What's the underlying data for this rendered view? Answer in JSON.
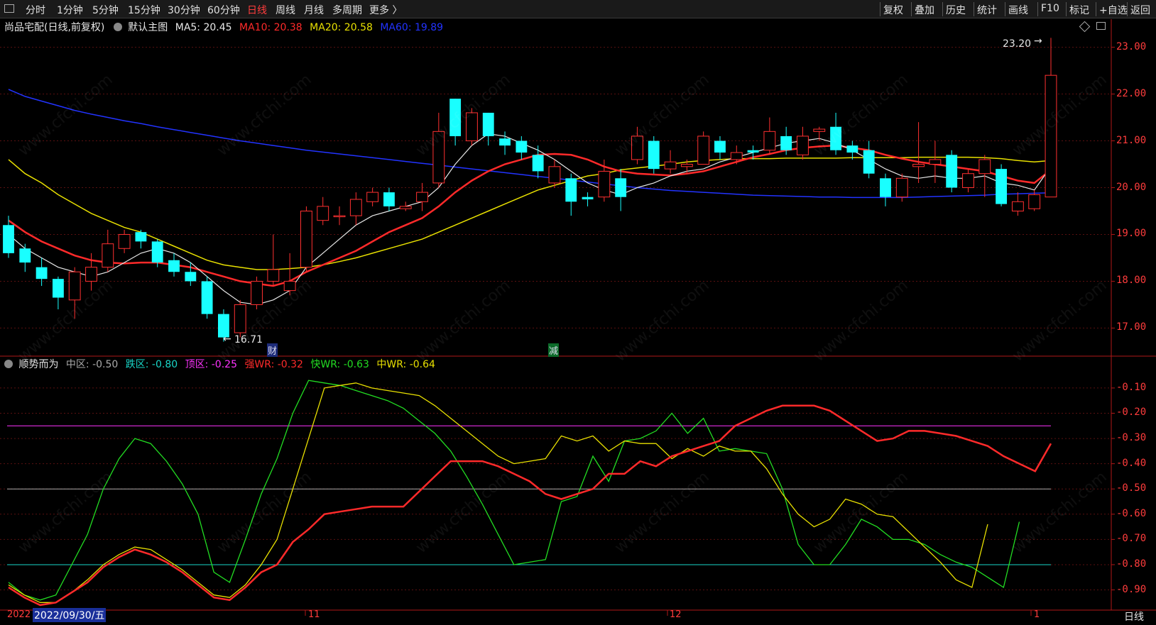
{
  "toolbar": {
    "periods": [
      "分时",
      "1分钟",
      "5分钟",
      "15分钟",
      "30分钟",
      "60分钟",
      "日线",
      "周线",
      "月线",
      "多周期",
      "更多 〉"
    ],
    "active_period": "日线",
    "right_buttons": [
      "复权",
      "叠加",
      "历史",
      "统计",
      "画线",
      "F10",
      "标记",
      "+自选",
      "返回"
    ]
  },
  "main_panel": {
    "stock_name": "尚品宅配(日线,前复权)",
    "template": "默认主图",
    "ma5": {
      "label": "MA5: 20.45",
      "color": "#e8e8e8"
    },
    "ma10": {
      "label": "MA10: 20.38",
      "color": "#ff2a2a"
    },
    "ma20": {
      "label": "MA20: 20.58",
      "color": "#e8e000"
    },
    "ma60": {
      "label": "MA60: 19.89",
      "color": "#2233ff"
    },
    "high_label": "23.20",
    "low_label": "16.71",
    "y_ticks": [
      "23.00",
      "22.00",
      "21.00",
      "20.00",
      "19.00",
      "18.00",
      "17.00"
    ],
    "event_markers": [
      "财",
      "减"
    ]
  },
  "indicator_panel": {
    "name": "顺势而为",
    "mid": {
      "label": "中区: -0.50",
      "color": "#aaaaaa"
    },
    "low": {
      "label": "跌区: -0.80",
      "color": "#19d6c8"
    },
    "top": {
      "label": "顶区: -0.25",
      "color": "#ff33ff"
    },
    "strong": {
      "label": "强WR: -0.32",
      "color": "#ff2a2a"
    },
    "fast": {
      "label": "快WR: -0.63",
      "color": "#22dd22"
    },
    "medium": {
      "label": "中WR: -0.64",
      "color": "#e8e000"
    },
    "y_ticks": [
      "-0.10",
      "-0.20",
      "-0.30",
      "-0.40",
      "-0.50",
      "-0.60",
      "-0.70",
      "-0.80",
      "-0.90"
    ]
  },
  "x_axis": {
    "year_label": "2022",
    "cursor_date": "2022/09/30/五",
    "month_labels": [
      "11",
      "12",
      "1"
    ]
  },
  "bottom_right": "日线",
  "watermark": "www.cfchi.com",
  "chart_data": [
    {
      "type": "candlestick",
      "ylim": [
        16.4,
        23.6
      ],
      "candles": [
        {
          "o": 19.2,
          "c": 18.6,
          "h": 19.4,
          "l": 18.5
        },
        {
          "o": 18.7,
          "c": 18.4,
          "h": 18.8,
          "l": 18.2
        },
        {
          "o": 18.3,
          "c": 18.05,
          "h": 18.5,
          "l": 17.9
        },
        {
          "o": 18.05,
          "c": 17.65,
          "h": 18.1,
          "l": 17.4
        },
        {
          "o": 17.6,
          "c": 18.2,
          "h": 18.3,
          "l": 17.2
        },
        {
          "o": 18.0,
          "c": 18.3,
          "h": 18.6,
          "l": 17.8
        },
        {
          "o": 18.3,
          "c": 18.8,
          "h": 19.1,
          "l": 18.2
        },
        {
          "o": 18.7,
          "c": 19.0,
          "h": 19.1,
          "l": 18.6
        },
        {
          "o": 19.05,
          "c": 18.85,
          "h": 19.1,
          "l": 18.7
        },
        {
          "o": 18.85,
          "c": 18.4,
          "h": 18.9,
          "l": 18.3
        },
        {
          "o": 18.45,
          "c": 18.2,
          "h": 18.6,
          "l": 18.1
        },
        {
          "o": 18.2,
          "c": 18.0,
          "h": 18.4,
          "l": 17.9
        },
        {
          "o": 18.0,
          "c": 17.3,
          "h": 18.1,
          "l": 17.2
        },
        {
          "o": 17.3,
          "c": 16.8,
          "h": 17.4,
          "l": 16.71
        },
        {
          "o": 16.9,
          "c": 17.5,
          "h": 17.6,
          "l": 16.8
        },
        {
          "o": 17.5,
          "c": 18.0,
          "h": 18.1,
          "l": 17.4
        },
        {
          "o": 18.0,
          "c": 18.25,
          "h": 19.0,
          "l": 17.9
        },
        {
          "o": 17.8,
          "c": 18.0,
          "h": 18.6,
          "l": 17.7
        },
        {
          "o": 18.3,
          "c": 19.5,
          "h": 19.6,
          "l": 18.2
        },
        {
          "o": 19.3,
          "c": 19.6,
          "h": 19.8,
          "l": 19.2
        },
        {
          "o": 19.4,
          "c": 19.4,
          "h": 19.6,
          "l": 19.2
        },
        {
          "o": 19.4,
          "c": 19.75,
          "h": 19.9,
          "l": 19.2
        },
        {
          "o": 19.7,
          "c": 19.9,
          "h": 20.0,
          "l": 19.6
        },
        {
          "o": 19.9,
          "c": 19.6,
          "h": 20.0,
          "l": 19.5
        },
        {
          "o": 19.55,
          "c": 19.6,
          "h": 19.7,
          "l": 19.5
        },
        {
          "o": 19.7,
          "c": 19.9,
          "h": 20.1,
          "l": 19.5
        },
        {
          "o": 20.1,
          "c": 21.2,
          "h": 21.6,
          "l": 20.0
        },
        {
          "o": 21.9,
          "c": 21.1,
          "h": 21.9,
          "l": 20.9
        },
        {
          "o": 21.0,
          "c": 21.6,
          "h": 21.7,
          "l": 20.9
        },
        {
          "o": 21.6,
          "c": 21.1,
          "h": 21.6,
          "l": 20.9
        },
        {
          "o": 21.05,
          "c": 20.9,
          "h": 21.2,
          "l": 20.7
        },
        {
          "o": 21.0,
          "c": 20.75,
          "h": 21.1,
          "l": 20.6
        },
        {
          "o": 20.7,
          "c": 20.35,
          "h": 20.9,
          "l": 20.2
        },
        {
          "o": 20.1,
          "c": 20.45,
          "h": 20.6,
          "l": 20.0
        },
        {
          "o": 20.2,
          "c": 19.7,
          "h": 20.3,
          "l": 19.4
        },
        {
          "o": 19.8,
          "c": 19.75,
          "h": 19.9,
          "l": 19.6
        },
        {
          "o": 19.8,
          "c": 20.35,
          "h": 20.6,
          "l": 19.7
        },
        {
          "o": 20.2,
          "c": 19.8,
          "h": 20.4,
          "l": 19.5
        },
        {
          "o": 20.6,
          "c": 21.1,
          "h": 21.3,
          "l": 20.5
        },
        {
          "o": 21.0,
          "c": 20.4,
          "h": 21.1,
          "l": 20.3
        },
        {
          "o": 20.4,
          "c": 20.55,
          "h": 20.8,
          "l": 20.3
        },
        {
          "o": 20.45,
          "c": 20.5,
          "h": 20.6,
          "l": 20.3
        },
        {
          "o": 20.5,
          "c": 21.1,
          "h": 21.2,
          "l": 20.5
        },
        {
          "o": 21.0,
          "c": 20.75,
          "h": 21.1,
          "l": 20.6
        },
        {
          "o": 20.6,
          "c": 20.75,
          "h": 20.9,
          "l": 20.5
        },
        {
          "o": 20.8,
          "c": 20.75,
          "h": 20.9,
          "l": 20.6
        },
        {
          "o": 20.8,
          "c": 21.2,
          "h": 21.5,
          "l": 20.7
        },
        {
          "o": 21.1,
          "c": 20.8,
          "h": 21.3,
          "l": 20.7
        },
        {
          "o": 20.7,
          "c": 21.1,
          "h": 21.3,
          "l": 20.6
        },
        {
          "o": 21.2,
          "c": 21.25,
          "h": 21.3,
          "l": 21.0
        },
        {
          "o": 21.3,
          "c": 20.8,
          "h": 21.6,
          "l": 20.7
        },
        {
          "o": 20.9,
          "c": 20.75,
          "h": 21.0,
          "l": 20.6
        },
        {
          "o": 20.8,
          "c": 20.3,
          "h": 21.0,
          "l": 20.2
        },
        {
          "o": 20.2,
          "c": 19.8,
          "h": 20.3,
          "l": 19.6
        },
        {
          "o": 19.8,
          "c": 20.2,
          "h": 20.3,
          "l": 19.7
        },
        {
          "o": 20.45,
          "c": 20.5,
          "h": 21.4,
          "l": 20.1
        },
        {
          "o": 20.5,
          "c": 20.6,
          "h": 21.0,
          "l": 20.1
        },
        {
          "o": 20.7,
          "c": 20.0,
          "h": 20.8,
          "l": 19.9
        },
        {
          "o": 20.0,
          "c": 20.3,
          "h": 20.4,
          "l": 19.9
        },
        {
          "o": 20.3,
          "c": 20.6,
          "h": 20.7,
          "l": 19.8
        },
        {
          "o": 20.4,
          "c": 19.65,
          "h": 20.5,
          "l": 19.6
        },
        {
          "o": 19.5,
          "c": 19.7,
          "h": 19.9,
          "l": 19.4
        },
        {
          "o": 19.55,
          "c": 19.85,
          "h": 19.95,
          "l": 19.5
        },
        {
          "o": 19.8,
          "c": 22.4,
          "h": 23.2,
          "l": 19.8
        }
      ],
      "ma5": [
        19.0,
        18.7,
        18.5,
        18.3,
        18.2,
        18.1,
        18.2,
        18.4,
        18.6,
        18.7,
        18.6,
        18.4,
        18.1,
        17.8,
        17.55,
        17.5,
        17.6,
        17.8,
        18.3,
        18.6,
        18.9,
        19.2,
        19.4,
        19.5,
        19.6,
        19.7,
        20.0,
        20.5,
        20.9,
        21.15,
        21.1,
        20.95,
        20.8,
        20.6,
        20.35,
        20.1,
        19.95,
        19.85,
        20.0,
        20.1,
        20.25,
        20.35,
        20.4,
        20.55,
        20.65,
        20.75,
        20.85,
        20.95,
        21.0,
        21.05,
        20.95,
        20.8,
        20.6,
        20.4,
        20.25,
        20.2,
        20.25,
        20.2,
        20.2,
        20.25,
        20.1,
        20.05,
        19.95,
        20.45
      ],
      "ma10": [
        19.3,
        19.05,
        18.85,
        18.7,
        18.55,
        18.45,
        18.4,
        18.38,
        18.4,
        18.4,
        18.35,
        18.3,
        18.2,
        18.1,
        18.0,
        17.95,
        17.9,
        18.0,
        18.2,
        18.35,
        18.5,
        18.65,
        18.85,
        19.05,
        19.2,
        19.35,
        19.6,
        19.9,
        20.15,
        20.35,
        20.5,
        20.6,
        20.7,
        20.72,
        20.7,
        20.6,
        20.45,
        20.35,
        20.3,
        20.28,
        20.26,
        20.3,
        20.35,
        20.45,
        20.55,
        20.65,
        20.72,
        20.8,
        20.85,
        20.88,
        20.9,
        20.85,
        20.8,
        20.7,
        20.62,
        20.55,
        20.5,
        20.45,
        20.4,
        20.35,
        20.25,
        20.15,
        20.1,
        20.38
      ],
      "ma20": [
        20.6,
        20.3,
        20.1,
        19.85,
        19.65,
        19.45,
        19.3,
        19.15,
        19.05,
        18.9,
        18.75,
        18.6,
        18.45,
        18.35,
        18.3,
        18.25,
        18.25,
        18.27,
        18.3,
        18.35,
        18.42,
        18.5,
        18.6,
        18.7,
        18.8,
        18.9,
        19.05,
        19.2,
        19.35,
        19.5,
        19.65,
        19.8,
        19.95,
        20.05,
        20.15,
        20.25,
        20.3,
        20.38,
        20.42,
        20.46,
        20.5,
        20.55,
        20.58,
        20.6,
        20.62,
        20.62,
        20.62,
        20.63,
        20.63,
        20.63,
        20.63,
        20.64,
        20.64,
        20.64,
        20.64,
        20.65,
        20.65,
        20.65,
        20.65,
        20.64,
        20.62,
        20.58,
        20.55,
        20.58
      ],
      "ma60": [
        22.1,
        21.95,
        21.85,
        21.75,
        21.65,
        21.57,
        21.5,
        21.43,
        21.37,
        21.3,
        21.24,
        21.18,
        21.12,
        21.06,
        21.0,
        20.95,
        20.9,
        20.85,
        20.8,
        20.76,
        20.72,
        20.68,
        20.64,
        20.6,
        20.56,
        20.52,
        20.48,
        20.44,
        20.4,
        20.36,
        20.32,
        20.28,
        20.24,
        20.2,
        20.16,
        20.12,
        20.08,
        20.04,
        20.0,
        19.97,
        19.94,
        19.92,
        19.9,
        19.88,
        19.86,
        19.84,
        19.83,
        19.82,
        19.81,
        19.8,
        19.8,
        19.79,
        19.79,
        19.79,
        19.79,
        19.8,
        19.81,
        19.82,
        19.83,
        19.84,
        19.86,
        19.87,
        19.88,
        19.89
      ]
    },
    {
      "type": "line",
      "ylim": [
        -0.98,
        -0.03
      ],
      "hlines": [
        {
          "value": -0.25,
          "color": "#ff33ff"
        },
        {
          "value": -0.5,
          "color": "#aaaaaa"
        },
        {
          "value": -0.8,
          "color": "#19d6c8"
        }
      ],
      "series": [
        {
          "name": "强WR",
          "color": "#ff2a2a",
          "values": [
            -0.89,
            -0.93,
            -0.96,
            -0.95,
            -0.91,
            -0.87,
            -0.81,
            -0.77,
            -0.74,
            -0.76,
            -0.79,
            -0.83,
            -0.88,
            -0.93,
            -0.94,
            -0.89,
            -0.83,
            -0.8,
            -0.71,
            -0.66,
            -0.6,
            -0.59,
            -0.58,
            -0.57,
            -0.57,
            -0.57,
            -0.51,
            -0.45,
            -0.39,
            -0.39,
            -0.39,
            -0.41,
            -0.44,
            -0.47,
            -0.52,
            -0.54,
            -0.52,
            -0.5,
            -0.44,
            -0.44,
            -0.39,
            -0.41,
            -0.37,
            -0.35,
            -0.33,
            -0.31,
            -0.25,
            -0.22,
            -0.19,
            -0.17,
            -0.17,
            -0.17,
            -0.19,
            -0.23,
            -0.27,
            -0.31,
            -0.3,
            -0.27,
            -0.27,
            -0.28,
            -0.29,
            -0.31,
            -0.33,
            -0.37,
            -0.4,
            -0.43,
            -0.32
          ]
        },
        {
          "name": "快WR",
          "color": "#22dd22",
          "values": [
            -0.87,
            -0.92,
            -0.94,
            -0.92,
            -0.8,
            -0.68,
            -0.5,
            -0.38,
            -0.3,
            -0.32,
            -0.39,
            -0.48,
            -0.6,
            -0.83,
            -0.87,
            -0.7,
            -0.52,
            -0.38,
            -0.2,
            -0.07,
            -0.08,
            -0.09,
            -0.11,
            -0.13,
            -0.15,
            -0.18,
            -0.23,
            -0.28,
            -0.35,
            -0.45,
            -0.56,
            -0.68,
            -0.8,
            -0.79,
            -0.78,
            -0.55,
            -0.53,
            -0.37,
            -0.47,
            -0.31,
            -0.3,
            -0.27,
            -0.2,
            -0.28,
            -0.22,
            -0.35,
            -0.34,
            -0.35,
            -0.36,
            -0.5,
            -0.72,
            -0.8,
            -0.8,
            -0.72,
            -0.62,
            -0.65,
            -0.7,
            -0.7,
            -0.72,
            -0.76,
            -0.79,
            -0.81,
            -0.85,
            -0.89,
            -0.63
          ]
        },
        {
          "name": "中WR",
          "color": "#e8e000",
          "values": [
            -0.88,
            -0.92,
            -0.95,
            -0.95,
            -0.91,
            -0.86,
            -0.8,
            -0.76,
            -0.73,
            -0.74,
            -0.78,
            -0.82,
            -0.87,
            -0.92,
            -0.93,
            -0.88,
            -0.8,
            -0.7,
            -0.5,
            -0.3,
            -0.1,
            -0.09,
            -0.08,
            -0.1,
            -0.11,
            -0.12,
            -0.13,
            -0.17,
            -0.22,
            -0.27,
            -0.32,
            -0.37,
            -0.4,
            -0.39,
            -0.38,
            -0.29,
            -0.31,
            -0.29,
            -0.35,
            -0.31,
            -0.32,
            -0.32,
            -0.38,
            -0.34,
            -0.37,
            -0.33,
            -0.35,
            -0.35,
            -0.42,
            -0.52,
            -0.6,
            -0.65,
            -0.62,
            -0.54,
            -0.56,
            -0.6,
            -0.61,
            -0.67,
            -0.73,
            -0.79,
            -0.86,
            -0.89,
            -0.64
          ]
        }
      ]
    }
  ]
}
